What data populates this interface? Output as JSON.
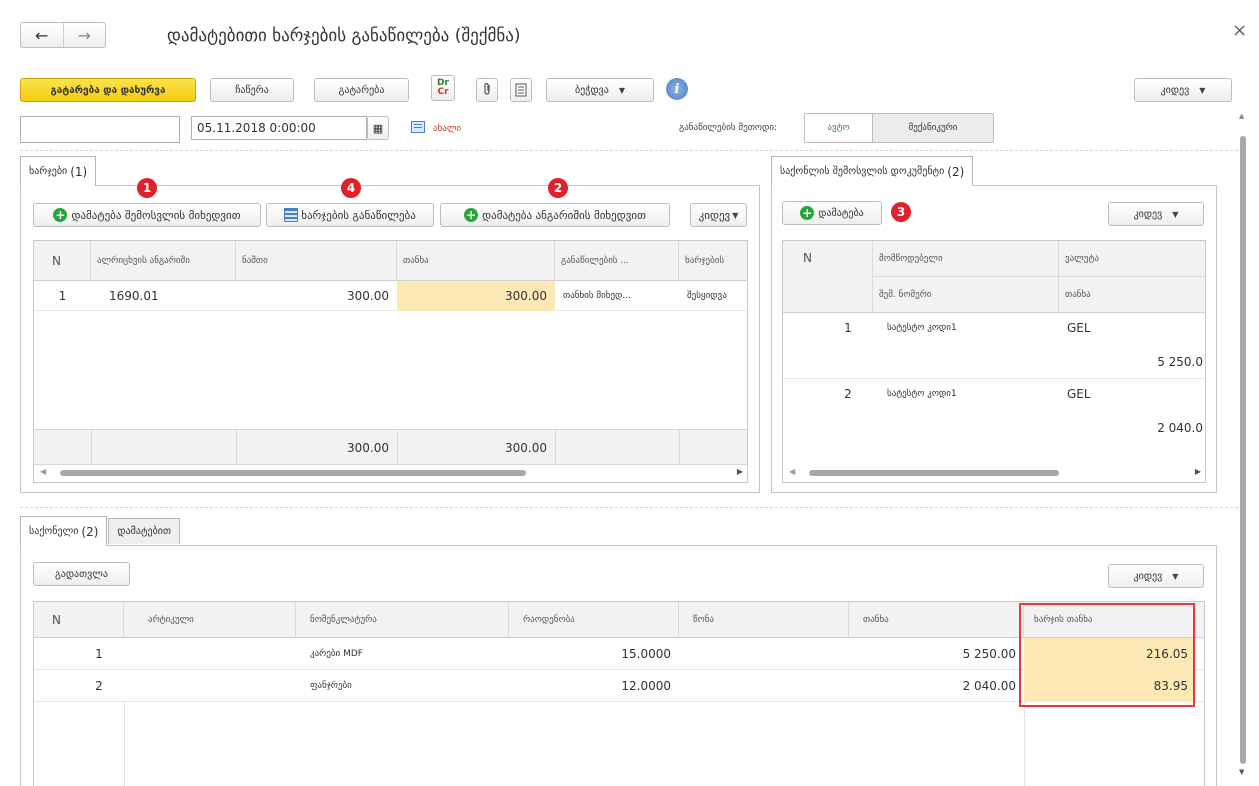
{
  "window": {
    "title": "დამატებითი ხარჯების განაწილება (შექმნა)",
    "back_glyph": "←",
    "forward_glyph": "→",
    "close_glyph": "×"
  },
  "toolbar": {
    "post_close": "გატარება და დახურვა",
    "write": "ჩაწერა",
    "post": "გატარება",
    "drcr_top": "Dr",
    "drcr_bottom": "Cr",
    "print": "ბეჭდვა",
    "more": "კიდევ",
    "info_glyph": "i",
    "attach_glyph": "🔗",
    "doc_glyph": "▤",
    "dropdown_glyph": "▼"
  },
  "header": {
    "number_value": "",
    "date_value": "05.11.2018 0:00:00",
    "calendar_glyph": "▦",
    "status_link": "ახალი",
    "method_label": "განაწილების მეთოდი:",
    "method_auto": "ავტო",
    "method_manual": "მექანიკური"
  },
  "costs_panel": {
    "tab_label": "ხარჯები",
    "tab_count": "(1)",
    "btn_add_by_receipt": "დამატება შემოსვლის მიხედვით",
    "btn_distribute": "ხარჯების განაწილება",
    "btn_add_by_account": "დამატება ანგარიშის მიხედვით",
    "btn_more": "კიდევ",
    "badges": [
      "1",
      "4",
      "2"
    ],
    "columns": [
      "N",
      "ალრიცხვის ანგარიში",
      "ნაშთი",
      "თანხა",
      "განაწილების ...",
      "ხარჯების"
    ],
    "rows": [
      {
        "n": "1",
        "account": "1690.01",
        "balance": "300.00",
        "amount": "300.00",
        "method": "თანხის მიხედ...",
        "costs": "შესყიდვა"
      }
    ],
    "totals": {
      "balance": "300.00",
      "amount": "300.00"
    }
  },
  "receipts_panel": {
    "tab_label": "საქონლის შემოსვლის დოკუმენტი",
    "tab_count": "(2)",
    "btn_add": "დამატება",
    "badge": "3",
    "btn_more": "კიდევ",
    "col_n": "N",
    "col_supplier": "მომწოდებელი",
    "col_supplier_sub": "შემ. ნომერი",
    "col_currency": "ვალუტა",
    "col_currency_sub": "თანხა",
    "rows": [
      {
        "n": "1",
        "supplier": "სატესტო კოდი1",
        "currency": "GEL",
        "amount": "5 250.0"
      },
      {
        "n": "2",
        "supplier": "სატესტო კოდი1",
        "currency": "GEL",
        "amount": "2 040.0"
      }
    ]
  },
  "goods_panel": {
    "tab_goods": "საქონელი",
    "tab_goods_count": "(2)",
    "tab_extra": "დამატებით",
    "btn_recalc": "გადათვლა",
    "btn_more": "კიდევ",
    "columns": [
      "N",
      "არტიკული",
      "ნომენკლატურა",
      "რაოდენობა",
      "წონა",
      "თანხა",
      "ხარჯის თანხა"
    ],
    "rows": [
      {
        "n": "1",
        "article": "",
        "item": "კარები MDF",
        "qty": "15.0000",
        "weight": "",
        "amount": "5 250.00",
        "cost": "216.05"
      },
      {
        "n": "2",
        "article": "",
        "item": "ფანჯრები",
        "qty": "12.0000",
        "weight": "",
        "amount": "2 040.00",
        "cost": "83.95"
      }
    ]
  },
  "colors": {
    "primary_button": "#f3cd0e",
    "highlight_cell": "#fde9b6",
    "badge": "#e0202a",
    "annotation_box": "#e23b3b",
    "add_icon": "#29a63b"
  }
}
